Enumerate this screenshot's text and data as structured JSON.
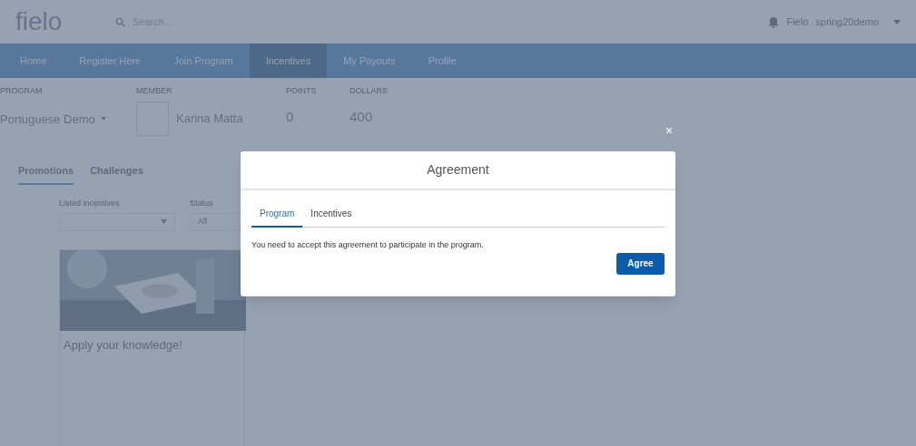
{
  "header": {
    "logo": "fielo",
    "search": {
      "placeholder": "Search..."
    },
    "user": "Fielo",
    "org": "spring20demo"
  },
  "nav": [
    {
      "label": "Home",
      "selected": false
    },
    {
      "label": "Register Here",
      "selected": false
    },
    {
      "label": "Join Program",
      "selected": false
    },
    {
      "label": "Incentives",
      "selected": true
    },
    {
      "label": "My Payouts",
      "selected": false
    },
    {
      "label": "Profile",
      "selected": false
    }
  ],
  "summary": {
    "program": {
      "label": "PROGRAM",
      "value": "Portuguese Demo"
    },
    "member": {
      "label": "MEMBER",
      "value": "Karina Matta"
    },
    "points": {
      "label": "POINTS",
      "value": "0"
    },
    "dollars": {
      "label": "DOLLARS",
      "value": "400"
    }
  },
  "tabs": [
    {
      "label": "Promotions",
      "selected": true
    },
    {
      "label": "Challenges",
      "selected": false
    }
  ],
  "filters": [
    {
      "label": "Listed incentives"
    },
    {
      "label": "Status",
      "value": "All"
    }
  ],
  "cards": [
    {
      "title": "Apply your knowledge!"
    }
  ],
  "modal": {
    "title": "Agreement",
    "close": "×",
    "tabs": [
      {
        "label": "Program",
        "selected": true
      },
      {
        "label": "Incentives",
        "selected": false
      }
    ],
    "text": "You need to accept this agreement to participate in the program.",
    "button": "Agree"
  }
}
